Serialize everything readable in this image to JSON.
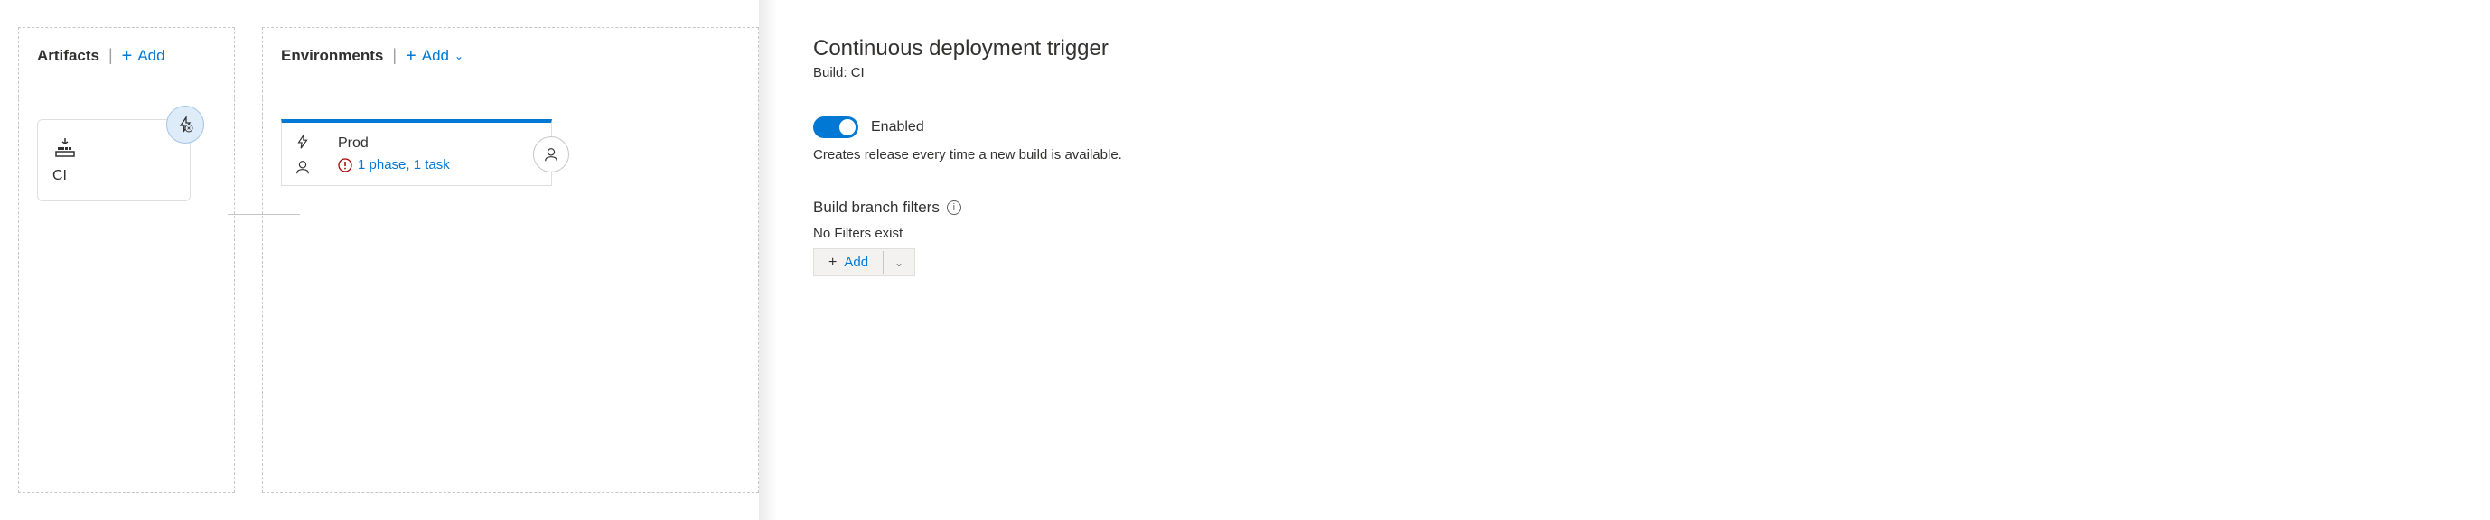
{
  "artifacts": {
    "section_title": "Artifacts",
    "add_label": "Add",
    "card": {
      "name": "CI"
    }
  },
  "environments": {
    "section_title": "Environments",
    "add_label": "Add",
    "card": {
      "name": "Prod",
      "tasks_text": "1 phase, 1 task"
    }
  },
  "panel": {
    "title": "Continuous deployment trigger",
    "subtitle": "Build: CI",
    "toggle_label": "Enabled",
    "toggle_desc": "Creates release every time a new build is available.",
    "filters_heading": "Build branch filters",
    "no_filters_text": "No Filters exist",
    "add_label": "Add"
  }
}
